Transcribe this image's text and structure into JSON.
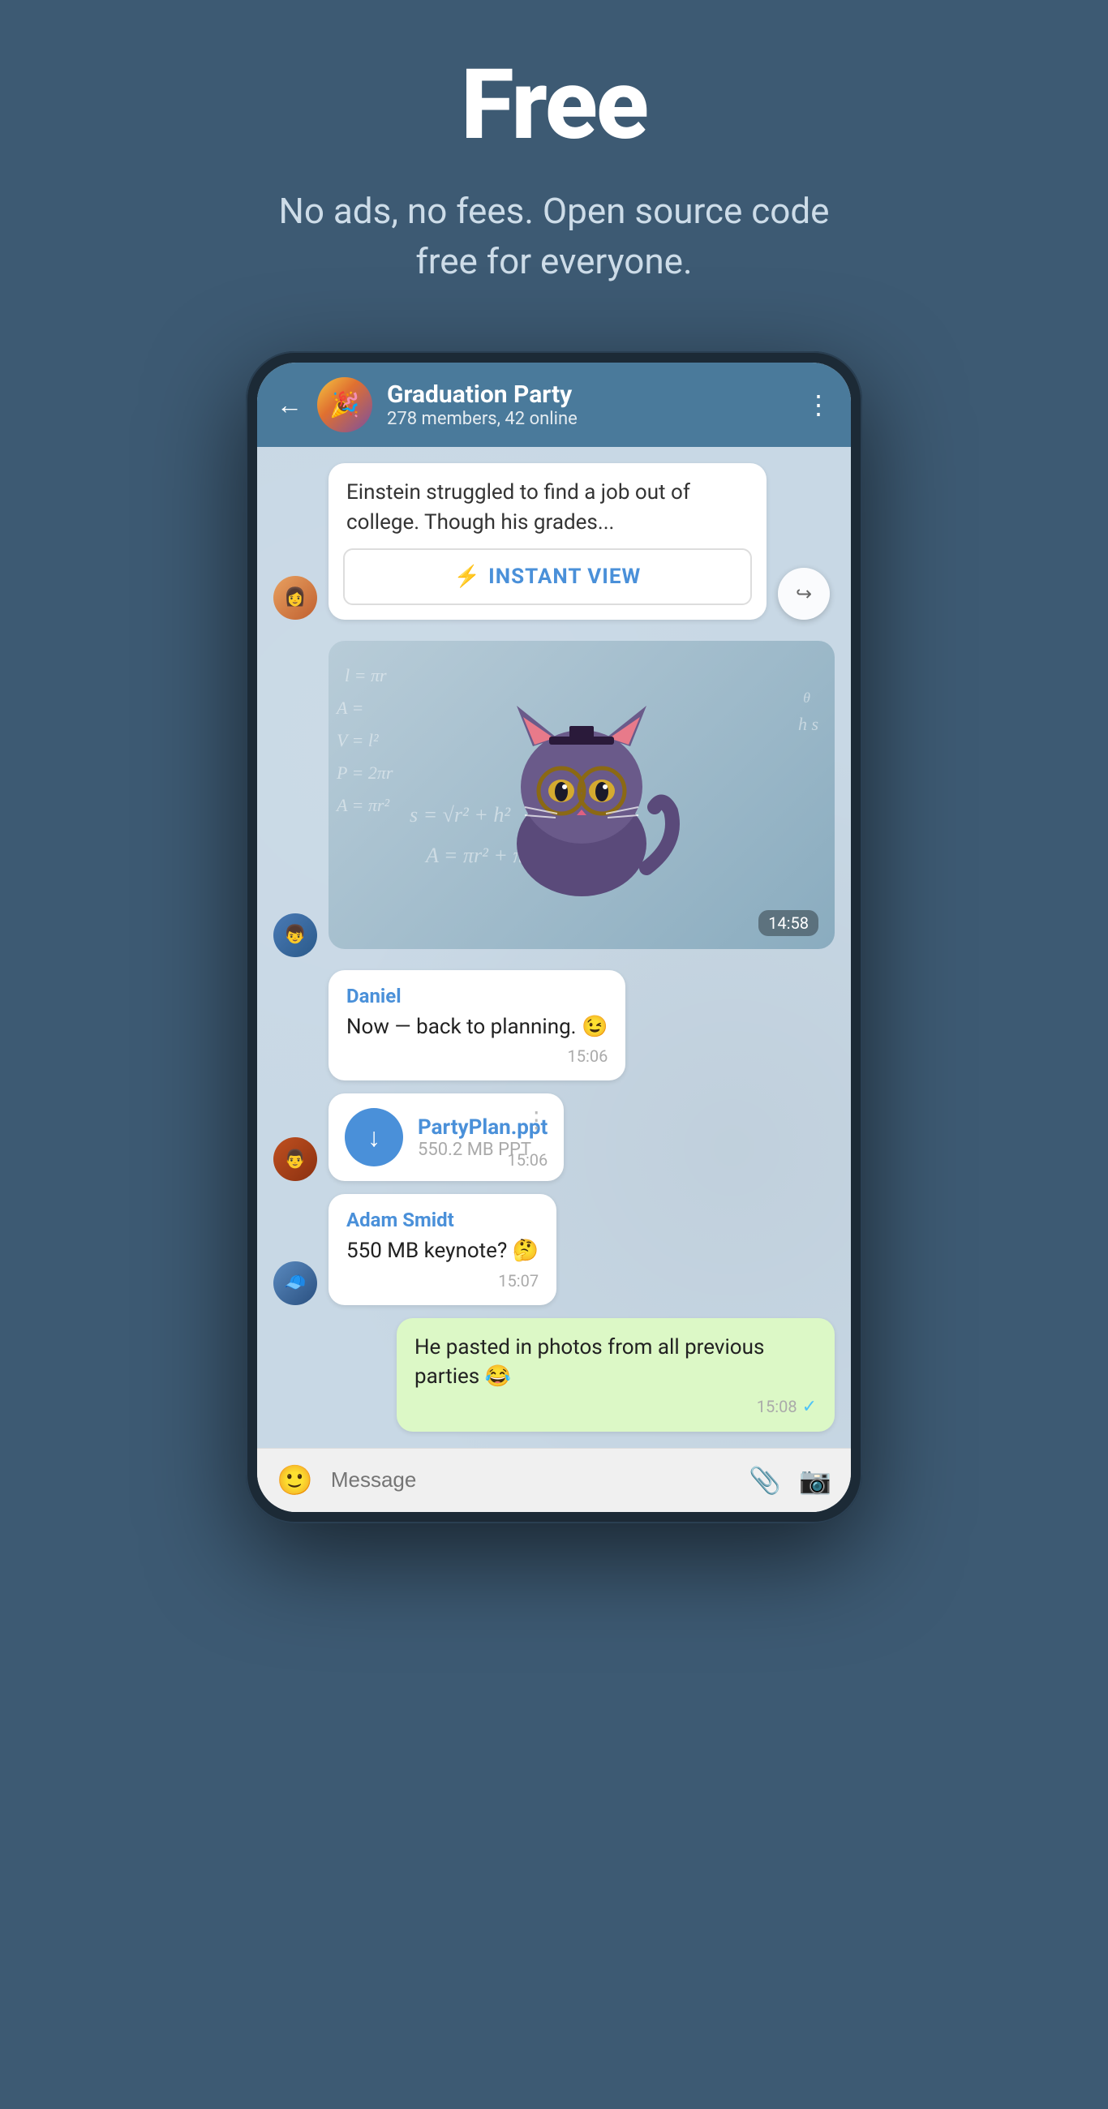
{
  "hero": {
    "title": "Free",
    "subtitle": "No ads, no fees. Open source code free for everyone."
  },
  "phone": {
    "header": {
      "group_name": "Graduation Party",
      "members_info": "278 members, 42 online",
      "back_label": "←",
      "more_label": "⋮"
    },
    "messages": [
      {
        "id": "iv-msg",
        "type": "instant_view",
        "text": "Einstein struggled to find a job out of college. Though his grades...",
        "button_label": "INSTANT VIEW",
        "avatar_type": "girl"
      },
      {
        "id": "sticker-msg",
        "type": "sticker",
        "time": "14:58",
        "avatar_type": "boy"
      },
      {
        "id": "daniel-msg",
        "type": "text",
        "sender": "Daniel",
        "text": "Now — back to planning. 😉",
        "time": "15:06",
        "bubble_color": "white"
      },
      {
        "id": "file-msg",
        "type": "file",
        "file_name": "PartyPlan.ppt",
        "file_size": "550.2 MB PPT",
        "time": "15:06",
        "avatar_type": "man"
      },
      {
        "id": "adam-msg",
        "type": "text",
        "sender": "Adam Smidt",
        "text": "550 MB keynote? 🤔",
        "time": "15:07",
        "bubble_color": "white",
        "avatar_type": "cap"
      },
      {
        "id": "my-msg",
        "type": "text",
        "sender": "",
        "text": "He pasted in photos from all previous parties 😂",
        "time": "15:08",
        "bubble_color": "green",
        "direction": "right",
        "checkmark": true
      }
    ],
    "input_bar": {
      "placeholder": "Message",
      "emoji_icon": "emoji",
      "attach_icon": "paperclip",
      "camera_icon": "camera"
    }
  }
}
